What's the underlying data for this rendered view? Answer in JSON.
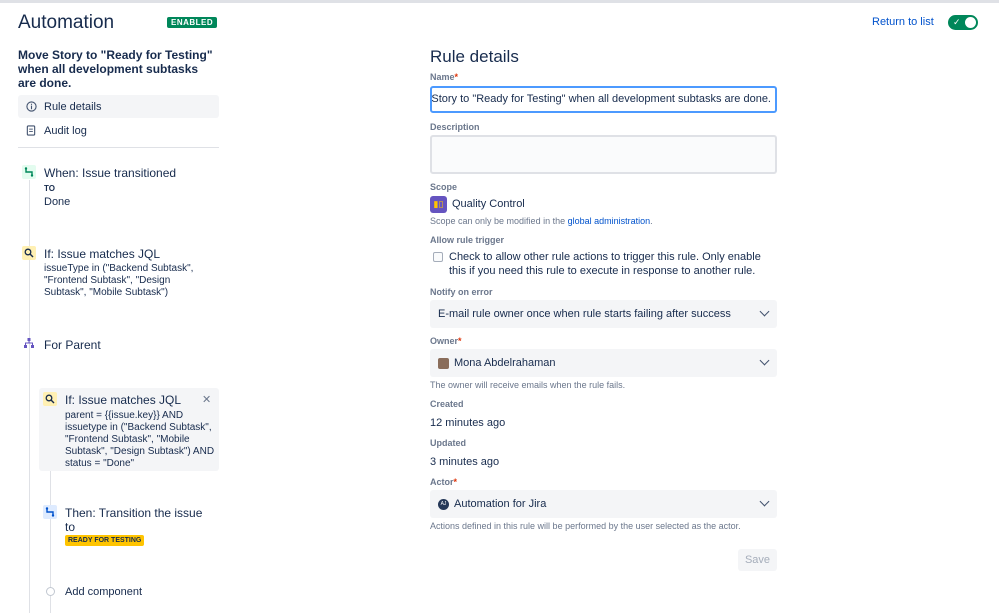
{
  "app": {
    "title": "Automation",
    "status_badge": "ENABLED",
    "return_link": "Return to list"
  },
  "rule": {
    "name": "Move Story to \"Ready for Testing\" when all development subtasks are done."
  },
  "nav": [
    {
      "label": "Rule details",
      "icon": "info-icon"
    },
    {
      "label": "Audit log",
      "icon": "document-icon"
    }
  ],
  "components": {
    "trigger": {
      "title": "When: Issue transitioned",
      "to_label": "TO",
      "to_value": "Done"
    },
    "condition1": {
      "title": "If: Issue matches JQL",
      "jql": "issueType in (\"Backend Subtask\", \"Frontend Subtask\", \"Design Subtask\", \"Mobile Subtask\")"
    },
    "branch": {
      "title": "For Parent"
    },
    "condition2": {
      "title": "If: Issue matches JQL",
      "jql": "parent = {{issue.key}} AND issuetype in (\"Backend Subtask\", \"Frontend Subtask\", \"Mobile Subtask\", \"Design Subtask\") AND status = \"Done\""
    },
    "action": {
      "title": "Then: Transition the issue to",
      "status": "READY FOR TESTING"
    },
    "add_component": "Add component"
  },
  "form": {
    "title": "Rule details",
    "name_label": "Name",
    "name_value": "Move Story to \"Ready for Testing\" when all development subtasks are done.",
    "description_label": "Description",
    "scope_label": "Scope",
    "scope_value": "Quality Control",
    "scope_help_prefix": "Scope can only be modified in the",
    "scope_help_link": "global administration",
    "scope_help_suffix": ".",
    "allow_trigger_label": "Allow rule trigger",
    "allow_trigger_text": "Check to allow other rule actions to trigger this rule. Only enable this if you need this rule to execute in response to another rule.",
    "notify_label": "Notify on error",
    "notify_value": "E-mail rule owner once when rule starts failing after success",
    "owner_label": "Owner",
    "owner_value": "Mona Abdelrahaman",
    "owner_help": "The owner will receive emails when the rule fails.",
    "created_label": "Created",
    "created_value": "12 minutes ago",
    "updated_label": "Updated",
    "updated_value": "3 minutes ago",
    "actor_label": "Actor",
    "actor_value": "Automation for Jira",
    "actor_avatar_text": "AJ",
    "actor_help": "Actions defined in this rule will be performed by the user selected as the actor.",
    "save_label": "Save"
  },
  "colors": {
    "accent": "#0052cc",
    "enabled": "#00875a",
    "lozenge": "#ffc400",
    "scope": "#6554c0"
  }
}
